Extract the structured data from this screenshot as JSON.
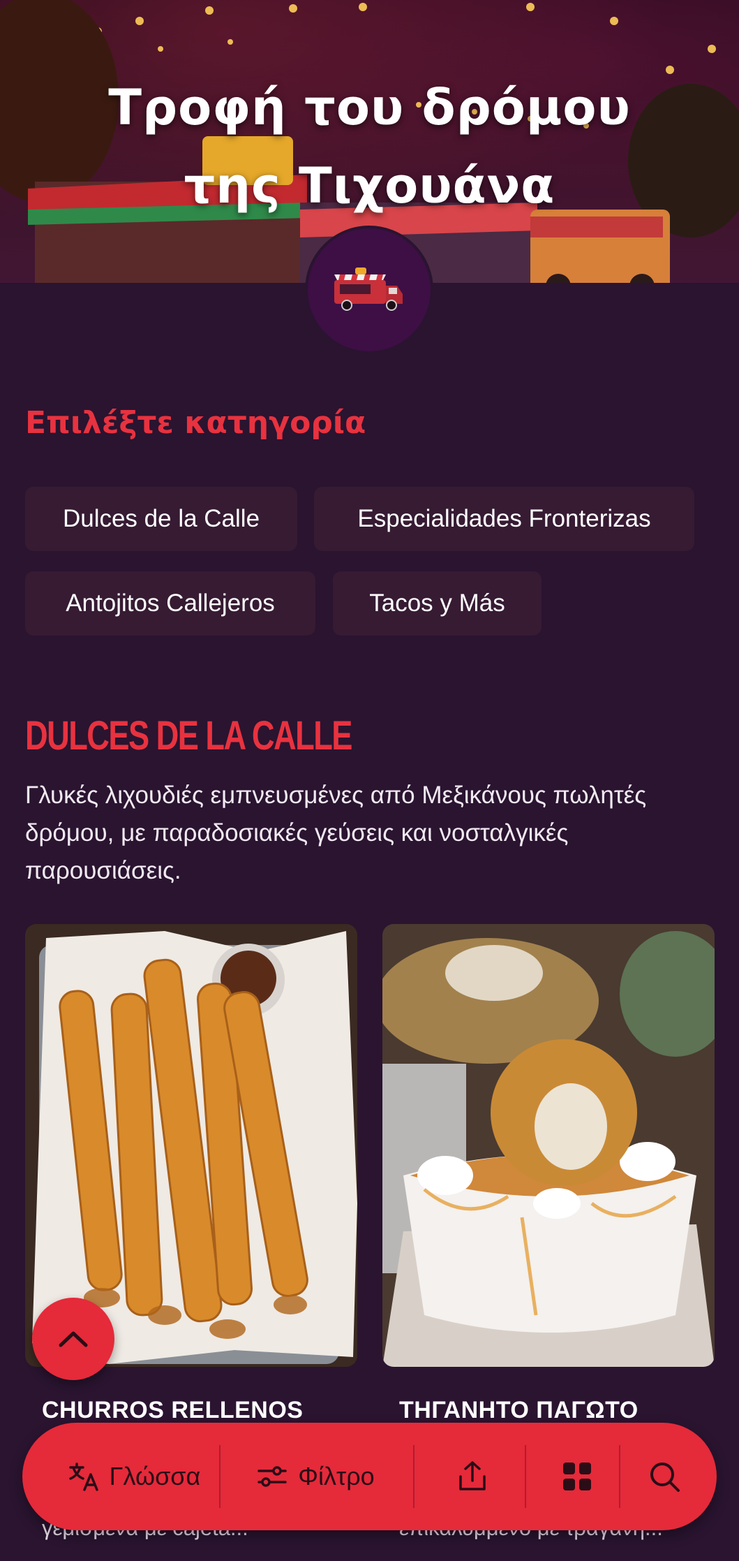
{
  "hero": {
    "title": "Τροφή του δρόμου της Τιχουάνα",
    "logo_icon": "food-truck-icon"
  },
  "category_picker": {
    "label": "Επιλέξτε κατηγορία",
    "chips": [
      "Dulces de la Calle",
      "Especialidades Fronterizas",
      "Antojitos Callejeros",
      "Tacos y Más"
    ]
  },
  "category": {
    "heading": "DULCES DE LA CALLE",
    "description": "Γλυκές λιχουδιές εμπνευσμένες από Μεξικάνους πωλητές δρόμου, με παραδοσιακές γεύσεις και νοσταλγικές παρουσιάσεις."
  },
  "items": [
    {
      "title": "CHURROS RELLENOS",
      "description": "γεμισμένα με cajeta...",
      "image": "churros-photo"
    },
    {
      "title": "ΤΗΓΑΝΗΤΟ ΠΑΓΩΤΟ",
      "description": "επικαλυμμένο με τραγανή...",
      "image": "fried-ice-cream-photo"
    }
  ],
  "bottom_bar": {
    "language_label": "Γλώσσα",
    "filter_label": "Φίλτρο",
    "icons": [
      "translate-icon",
      "filter-icon",
      "share-icon",
      "grid-icon",
      "search-icon"
    ]
  },
  "colors": {
    "background": "#2a1430",
    "accent": "#e8323f",
    "chip": "#361b33",
    "bar": "#e52a3a"
  }
}
